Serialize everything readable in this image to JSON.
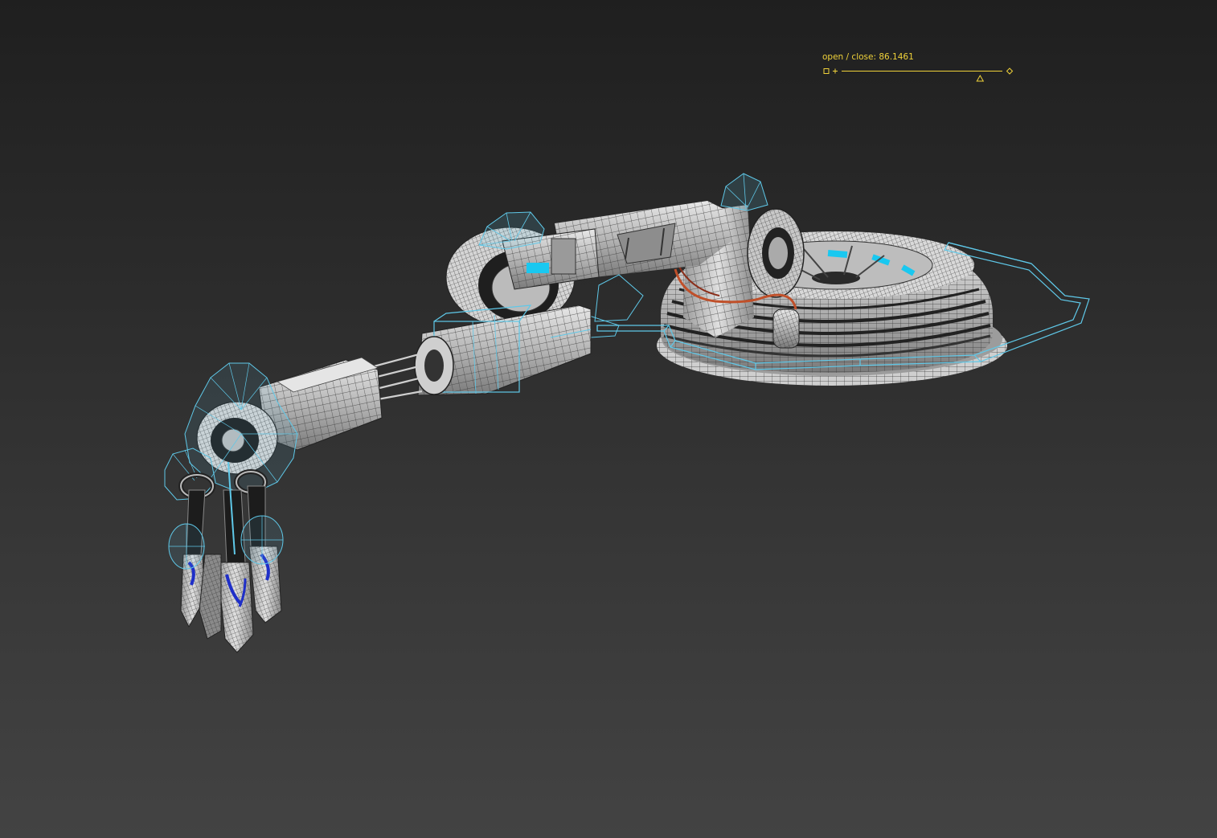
{
  "viewport": {
    "name": "perspective-viewport",
    "background_top": "#1f1f1f",
    "background_bottom": "#434343"
  },
  "manipulator": {
    "label": "open / close",
    "separator": ": ",
    "value": "86.1461",
    "fill_fraction": 0.861461,
    "color": "#f0d23a",
    "icons": [
      "reset-square-icon",
      "plus-icon",
      "triangle-handle-icon",
      "diamond-end-icon"
    ]
  },
  "model": {
    "description_icon": "robot-arm-model",
    "bone_color": "#5fc8e8",
    "mesh_color": "#bfbfbf",
    "wire_color": "#3a3a3a",
    "accent_cyan": "#19c8f0",
    "accent_blue": "#1f2fc8",
    "cable_color": "#c0502a"
  }
}
